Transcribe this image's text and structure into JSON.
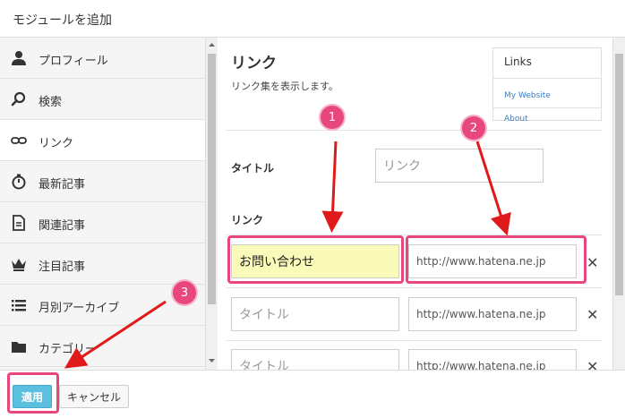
{
  "dialog": {
    "title": "モジュールを追加"
  },
  "sidebar": {
    "items": [
      {
        "label": "プロフィール",
        "icon": "person-icon",
        "active": false
      },
      {
        "label": "検索",
        "icon": "search-icon",
        "active": false
      },
      {
        "label": "リンク",
        "icon": "link-icon",
        "active": true
      },
      {
        "label": "最新記事",
        "icon": "stopwatch-icon",
        "active": false
      },
      {
        "label": "関連記事",
        "icon": "document-icon",
        "active": false
      },
      {
        "label": "注目記事",
        "icon": "crown-icon",
        "active": false
      },
      {
        "label": "月別アーカイブ",
        "icon": "list-icon",
        "active": false
      },
      {
        "label": "カテゴリー",
        "icon": "folder-icon",
        "active": false
      }
    ]
  },
  "module": {
    "title": "リンク",
    "description": "リンク集を表示します。",
    "preview": {
      "title": "Links",
      "links": [
        "My Website",
        "About"
      ]
    },
    "title_field": {
      "label": "タイトル",
      "placeholder": "リンク"
    },
    "links_label": "リンク",
    "rows": [
      {
        "name": "お問い合わせ",
        "name_placeholder": "タイトル",
        "url_placeholder": "http://www.hatena.ne.jp"
      },
      {
        "name": "",
        "name_placeholder": "タイトル",
        "url_placeholder": "http://www.hatena.ne.jp"
      },
      {
        "name": "",
        "name_placeholder": "タイトル",
        "url_placeholder": "http://www.hatena.ne.jp"
      }
    ],
    "delete_symbol": "✕"
  },
  "footer": {
    "apply_label": "適用",
    "cancel_label": "キャンセル"
  },
  "annotations": {
    "badges": [
      "1",
      "2",
      "3"
    ],
    "color": "#e8467e"
  }
}
